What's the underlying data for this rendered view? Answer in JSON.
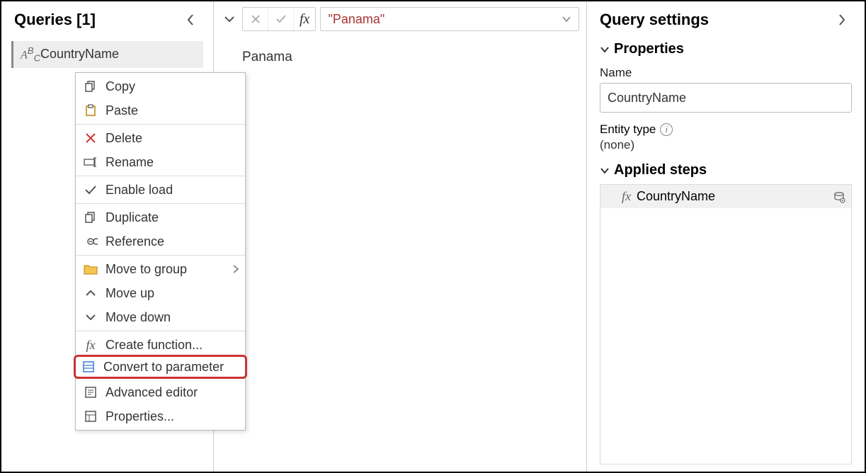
{
  "left": {
    "title": "Queries [1]",
    "query_name": "CountryName"
  },
  "context_menu": {
    "copy": "Copy",
    "paste": "Paste",
    "delete": "Delete",
    "rename": "Rename",
    "enable_load": "Enable load",
    "duplicate": "Duplicate",
    "reference": "Reference",
    "move_to_group": "Move to group",
    "move_up": "Move up",
    "move_down": "Move down",
    "create_function": "Create function...",
    "convert_to_parameter": "Convert to parameter",
    "advanced_editor": "Advanced editor",
    "properties": "Properties..."
  },
  "center": {
    "formula_value": "\"Panama\"",
    "preview_value": "Panama"
  },
  "right": {
    "title": "Query settings",
    "properties_label": "Properties",
    "name_label": "Name",
    "name_value": "CountryName",
    "entity_type_label": "Entity type",
    "entity_type_value": "(none)",
    "applied_steps_label": "Applied steps",
    "step_name": "CountryName"
  }
}
